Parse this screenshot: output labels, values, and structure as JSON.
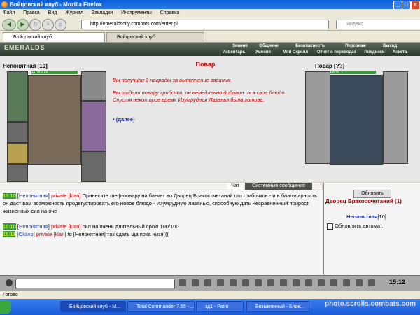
{
  "window": {
    "title": "Бойцовский клуб - Mozilla Firefox",
    "minimize": "_",
    "maximize": "□",
    "close": "×"
  },
  "menu": [
    "Файл",
    "Правка",
    "Вид",
    "Журнал",
    "Закладки",
    "Инструменты",
    "Справка"
  ],
  "nav": {
    "url": "http://emeraldscity.combats.com/enter.pl",
    "search_placeholder": "Яндекс"
  },
  "tabs": [
    "Бойцовский клуб",
    "Бойцовский клуб"
  ],
  "game": {
    "logo": "EMERALDS",
    "nav_top": [
      "Знания",
      "Общение",
      "Безопасность",
      "Персонаж",
      "Выход"
    ],
    "nav_bottom": [
      "Инвентарь",
      "Умения",
      "Мой Скролл",
      "Отчет о переводах",
      "Поединки",
      "Анкета"
    ],
    "player": {
      "name": "Непонятная",
      "level": "[10]",
      "hp": "1179/1179"
    },
    "npc": {
      "name": "Повар",
      "level": "[??]",
      "hp": "100%"
    },
    "center": {
      "title": "Повар",
      "msg1": "Вы получили 0 награды за выполнение задания.",
      "msg2": "Вы отдали повару грибочки, он немедленно добавил их в свое блюдо. Спустя некоторое время Изумрудная Лазанья была готова.",
      "more": "• (далее)"
    },
    "chat_tabs": [
      "Чат",
      "Системные сообщения"
    ],
    "chat": [
      {
        "time": "15:10",
        "nick": "Непонятная",
        "tag": "private [klan]",
        "text": "Принесите шеф-повару на банкет во Дворец Бракосочетаний сто грибочков - и в благодарность он даст вам возможность продегустировать его новое блюдо - Изумрудную Лазанью, способную дать несравненный прирост жизненных сил на оче"
      },
      {
        "time": "15:10",
        "nick": "Непонятная",
        "tag": "private [klan]",
        "text": "сил на очень длительный срок! 100/100"
      },
      {
        "time": "15:11",
        "nick": "Oksvo",
        "tag": "private [klan]",
        "text": "to [Непонятная] так сдать ща пока низя((("
      }
    ],
    "side": {
      "refresh": "Обновить",
      "room": "Дворец Бракосочетаний (1)",
      "online_name": "Непонятная",
      "online_level": "[10]",
      "auto": "Обновлять автомат."
    },
    "clock": "15:12"
  },
  "status": "Готово",
  "taskbar": [
    "Бойцовский клуб - M...",
    "Total Commander 7.55 - ...",
    "зд1 - Paint",
    "Безымянный - Блок..."
  ],
  "watermark": "photo.scrolls.combats.com"
}
